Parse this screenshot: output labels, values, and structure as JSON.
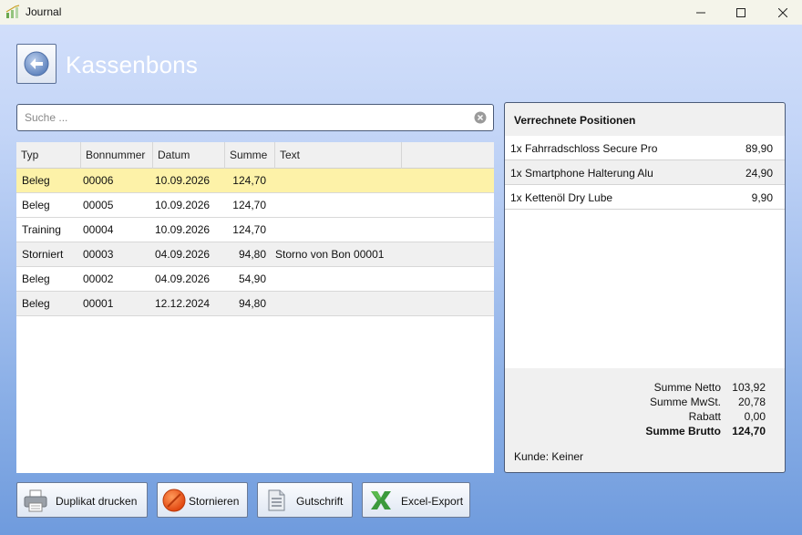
{
  "window": {
    "title": "Journal",
    "icon": "chart-icon"
  },
  "header": {
    "title": "Kassenbons",
    "back_icon": "arrow-left-icon"
  },
  "search": {
    "placeholder": "Suche ...",
    "value": ""
  },
  "grid": {
    "columns": [
      "Typ",
      "Bonnummer",
      "Datum",
      "Summe",
      "Text"
    ],
    "rows": [
      {
        "typ": "Beleg",
        "bonnummer": "00006",
        "datum": "10.09.2026",
        "summe": "124,70",
        "text": ""
      },
      {
        "typ": "Beleg",
        "bonnummer": "00005",
        "datum": "10.09.2026",
        "summe": "124,70",
        "text": ""
      },
      {
        "typ": "Training",
        "bonnummer": "00004",
        "datum": "10.09.2026",
        "summe": "124,70",
        "text": ""
      },
      {
        "typ": "Storniert",
        "bonnummer": "00003",
        "datum": "04.09.2026",
        "summe": "94,80",
        "text": "Storno von Bon 00001"
      },
      {
        "typ": "Beleg",
        "bonnummer": "00002",
        "datum": "04.09.2026",
        "summe": "54,90",
        "text": ""
      },
      {
        "typ": "Beleg",
        "bonnummer": "00001",
        "datum": "12.12.2024",
        "summe": "94,80",
        "text": ""
      }
    ],
    "selected_row": 0,
    "selected_color": "#fdf2a8"
  },
  "positions": {
    "title": "Verrechnete Positionen",
    "items": [
      {
        "label": "1x Fahrradschloss Secure Pro",
        "price": "89,90"
      },
      {
        "label": "1x Smartphone Halterung Alu",
        "price": "24,90"
      },
      {
        "label": "1x Kettenöl Dry Lube",
        "price": "9,90"
      }
    ],
    "totals": {
      "netto_label": "Summe Netto",
      "netto": "103,92",
      "mwst_label": "Summe MwSt.",
      "mwst": "20,78",
      "rabatt_label": "Rabatt",
      "rabatt": "0,00",
      "brutto_label": "Summe Brutto",
      "brutto": "124,70"
    },
    "customer": "Kunde: Keiner"
  },
  "buttons": {
    "duplicate": {
      "label": "Duplikat drucken",
      "icon": "printer-icon"
    },
    "cancel": {
      "label": "Stornieren",
      "icon": "cancel-icon"
    },
    "credit": {
      "label": "Gutschrift",
      "icon": "document-icon"
    },
    "excel": {
      "label": "Excel-Export",
      "icon": "excel-icon"
    }
  }
}
